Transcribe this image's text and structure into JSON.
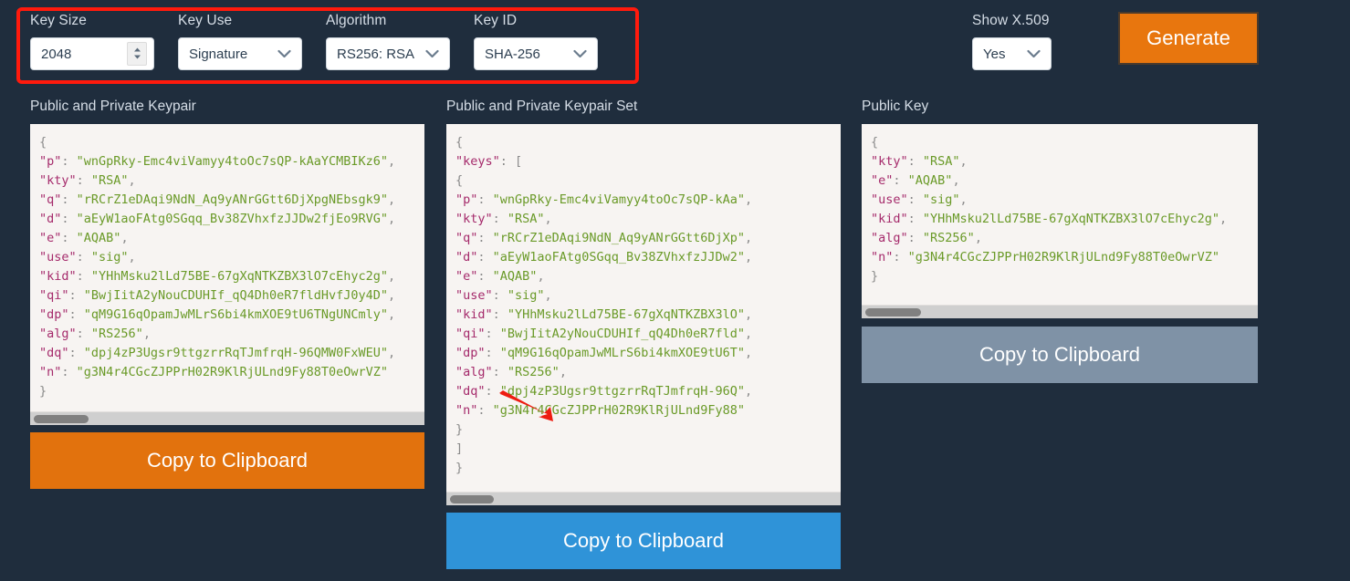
{
  "theme": {
    "background": "#1f2d3d",
    "highlight_border": "#ff1a0d",
    "accent_orange": "#e8760e",
    "accent_blue": "#2f93d8",
    "accent_grey": "#7f92a6",
    "code_background": "#f7f4f2"
  },
  "controls": {
    "key_size": {
      "label": "Key Size",
      "value": "2048",
      "type": "number-spinner"
    },
    "key_use": {
      "label": "Key Use",
      "value": "Signature",
      "type": "select"
    },
    "algorithm": {
      "label": "Algorithm",
      "value": "RS256: RSA",
      "type": "select"
    },
    "key_id": {
      "label": "Key ID",
      "value": "SHA-256",
      "type": "select"
    },
    "show_x509": {
      "label": "Show X.509",
      "value": "Yes",
      "type": "select"
    },
    "generate_button": "Generate"
  },
  "panels": [
    {
      "title": "Public and Private Keypair",
      "copy_label": "Copy to Clipboard",
      "lines": [
        {
          "indent": 0,
          "brace": "{"
        },
        {
          "indent": 1,
          "key": "p",
          "value": "wnGpRky-Emc4viVamyy4toOc7sQP-kAaYCMBIKz6",
          "comma": true
        },
        {
          "indent": 1,
          "key": "kty",
          "value": "RSA",
          "comma": true
        },
        {
          "indent": 1,
          "key": "q",
          "value": "rRCrZ1eDAqi9NdN_Aq9yANrGGtt6DjXpgNEbsgk9",
          "comma": true
        },
        {
          "indent": 1,
          "key": "d",
          "value": "aEyW1aoFAtg0SGqq_Bv38ZVhxfzJJDw2fjEo9RVG",
          "comma": true
        },
        {
          "indent": 1,
          "key": "e",
          "value": "AQAB",
          "comma": true
        },
        {
          "indent": 1,
          "key": "use",
          "value": "sig",
          "comma": true
        },
        {
          "indent": 1,
          "key": "kid",
          "value": "YHhMsku2lLd75BE-67gXqNTKZBX3lO7cEhyc2g",
          "comma": true
        },
        {
          "indent": 1,
          "key": "qi",
          "value": "BwjIitA2yNouCDUHIf_qQ4Dh0eR7fldHvfJ0y4D",
          "comma": true
        },
        {
          "indent": 1,
          "key": "dp",
          "value": "qM9G16qOpamJwMLrS6bi4kmXOE9tU6TNgUNCmly",
          "comma": true
        },
        {
          "indent": 1,
          "key": "alg",
          "value": "RS256",
          "comma": true
        },
        {
          "indent": 1,
          "key": "dq",
          "value": "dpj4zP3Ugsr9ttgzrrRqTJmfrqH-96QMW0FxWEU",
          "comma": true
        },
        {
          "indent": 1,
          "key": "n",
          "value": "g3N4r4CGcZJPPrH02R9KlRjULnd9Fy88T0eOwrVZ",
          "comma": false
        },
        {
          "indent": 0,
          "brace": "}"
        }
      ],
      "scroll_thumb_pct": 14
    },
    {
      "title": "Public and Private Keypair Set",
      "copy_label": "Copy to Clipboard",
      "lines": [
        {
          "indent": 0,
          "brace": "{"
        },
        {
          "indent": 1,
          "key": "keys",
          "bracket": "["
        },
        {
          "indent": 2,
          "brace": "{"
        },
        {
          "indent": 3,
          "key": "p",
          "value": "wnGpRky-Emc4viVamyy4toOc7sQP-kAa",
          "comma": true
        },
        {
          "indent": 3,
          "key": "kty",
          "value": "RSA",
          "comma": true
        },
        {
          "indent": 3,
          "key": "q",
          "value": "rRCrZ1eDAqi9NdN_Aq9yANrGGtt6DjXp",
          "comma": true
        },
        {
          "indent": 3,
          "key": "d",
          "value": "aEyW1aoFAtg0SGqq_Bv38ZVhxfzJJDw2",
          "comma": true
        },
        {
          "indent": 3,
          "key": "e",
          "value": "AQAB",
          "comma": true
        },
        {
          "indent": 3,
          "key": "use",
          "value": "sig",
          "comma": true
        },
        {
          "indent": 3,
          "key": "kid",
          "value": "YHhMsku2lLd75BE-67gXqNTKZBX3lO",
          "comma": true
        },
        {
          "indent": 3,
          "key": "qi",
          "value": "BwjIitA2yNouCDUHIf_qQ4Dh0eR7fld",
          "comma": true
        },
        {
          "indent": 3,
          "key": "dp",
          "value": "qM9G16qOpamJwMLrS6bi4kmXOE9tU6T",
          "comma": true
        },
        {
          "indent": 3,
          "key": "alg",
          "value": "RS256",
          "comma": true
        },
        {
          "indent": 3,
          "key": "dq",
          "value": "dpj4zP3Ugsr9ttgzrrRqTJmfrqH-96Q",
          "comma": true
        },
        {
          "indent": 3,
          "key": "n",
          "value": "g3N4r4CGcZJPPrH02R9KlRjULnd9Fy88",
          "comma": false
        },
        {
          "indent": 2,
          "brace": "}"
        },
        {
          "indent": 1,
          "bracket": "]"
        },
        {
          "indent": 0,
          "brace": "}"
        }
      ],
      "scroll_thumb_pct": 11
    },
    {
      "title": "Public Key",
      "copy_label": "Copy to Clipboard",
      "lines": [
        {
          "indent": 0,
          "brace": "{"
        },
        {
          "indent": 1,
          "key": "kty",
          "value": "RSA",
          "comma": true
        },
        {
          "indent": 1,
          "key": "e",
          "value": "AQAB",
          "comma": true
        },
        {
          "indent": 1,
          "key": "use",
          "value": "sig",
          "comma": true
        },
        {
          "indent": 1,
          "key": "kid",
          "value": "YHhMsku2lLd75BE-67gXqNTKZBX3lO7cEhyc2g",
          "comma": true
        },
        {
          "indent": 1,
          "key": "alg",
          "value": "RS256",
          "comma": true
        },
        {
          "indent": 1,
          "key": "n",
          "value": "g3N4r4CGcZJPPrH02R9KlRjULnd9Fy88T0eOwrVZ",
          "comma": false
        },
        {
          "indent": 0,
          "brace": "}"
        }
      ],
      "scroll_thumb_pct": 14
    }
  ],
  "annotations": {
    "highlight_box": "controls-group-highlight",
    "arrow": "points-to-n-field"
  }
}
